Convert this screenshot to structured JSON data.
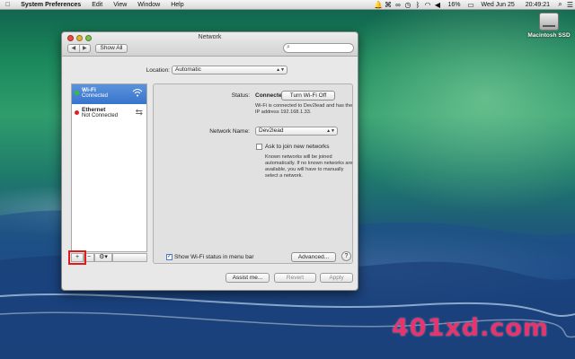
{
  "menubar": {
    "app_name": "System Preferences",
    "items": [
      "Edit",
      "View",
      "Window",
      "Help"
    ],
    "status": {
      "battery_percent": "16%",
      "date": "Wed Jun 25",
      "time": "20:49:21"
    }
  },
  "desktop": {
    "hd_label": "Macintosh SSD",
    "watermark": "401xd.com"
  },
  "window": {
    "title": "Network",
    "show_all": "Show All",
    "search_placeholder": "",
    "location_label": "Location:",
    "location_value": "Automatic",
    "services": [
      {
        "name": "Wi-Fi",
        "status": "Connected",
        "status_color": "#35c033",
        "icon": "wifi-icon",
        "selected": true
      },
      {
        "name": "Ethernet",
        "status": "Not Connected",
        "status_color": "#e02020",
        "icon": "ethernet-arrows-icon",
        "selected": false
      }
    ],
    "sidebar_buttons": {
      "add": "+",
      "remove": "−",
      "gear": "⚙▾"
    },
    "detail": {
      "status_label": "Status:",
      "status_value": "Connected",
      "turn_off_button": "Turn Wi-Fi Off",
      "status_description": "Wi-Fi is connected to Dev2lead and has the IP address 192.168.1.33.",
      "network_name_label": "Network Name:",
      "network_name_value": "Dev2lead",
      "ask_checkbox_label": "Ask to join new networks",
      "ask_description": "Known networks will be joined automatically. If no known networks are available, you will have to manually select a network.",
      "show_status_label": "Show Wi-Fi status in menu bar",
      "advanced_button": "Advanced...",
      "help_button": "?"
    },
    "bottom_buttons": {
      "assist": "Assist me...",
      "revert": "Revert",
      "apply": "Apply"
    }
  },
  "colors": {
    "selection": "#3d7bd0",
    "highlight_box": "#e21a1a",
    "watermark": "#e8336d"
  }
}
